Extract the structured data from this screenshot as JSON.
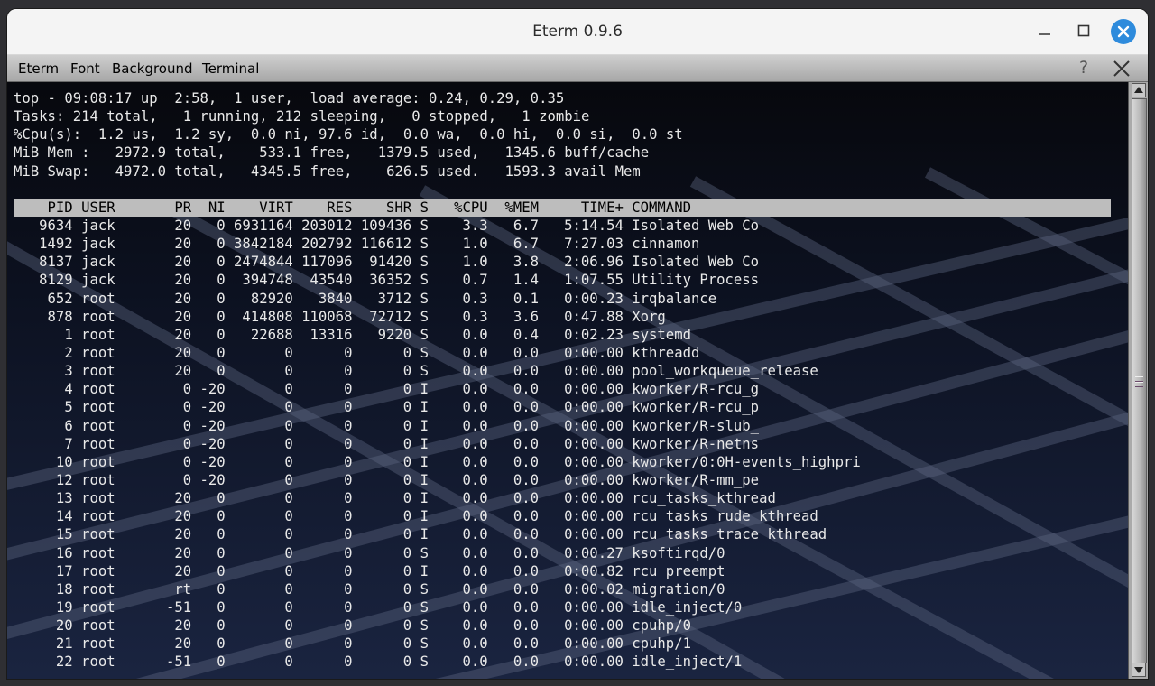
{
  "window": {
    "title": "Eterm 0.9.6"
  },
  "menubar": {
    "items": [
      "Eterm",
      "Font",
      "Background",
      "Terminal"
    ],
    "help_label": "?"
  },
  "terminal": {
    "summary": [
      "top - 09:08:17 up  2:58,  1 user,  load average: 0.24, 0.29, 0.35",
      "Tasks: 214 total,   1 running, 212 sleeping,   0 stopped,   1 zombie",
      "%Cpu(s):  1.2 us,  1.2 sy,  0.0 ni, 97.6 id,  0.0 wa,  0.0 hi,  0.0 si,  0.0 st",
      "MiB Mem :   2972.9 total,    533.1 free,   1379.5 used,   1345.6 buff/cache",
      "MiB Swap:   4972.0 total,   4345.5 free,    626.5 used.   1593.3 avail Mem",
      ""
    ],
    "columns": [
      "PID",
      "USER",
      "PR",
      "NI",
      "VIRT",
      "RES",
      "SHR",
      "S",
      "%CPU",
      "%MEM",
      "TIME+",
      "COMMAND"
    ],
    "processes": [
      {
        "pid": "9634",
        "user": "jack",
        "pr": "20",
        "ni": "0",
        "virt": "6931164",
        "res": "203012",
        "shr": "109436",
        "s": "S",
        "cpu": "3.3",
        "mem": "6.7",
        "time": "5:14.54",
        "cmd": "Isolated Web Co"
      },
      {
        "pid": "1492",
        "user": "jack",
        "pr": "20",
        "ni": "0",
        "virt": "3842184",
        "res": "202792",
        "shr": "116612",
        "s": "S",
        "cpu": "1.0",
        "mem": "6.7",
        "time": "7:27.03",
        "cmd": "cinnamon"
      },
      {
        "pid": "8137",
        "user": "jack",
        "pr": "20",
        "ni": "0",
        "virt": "2474844",
        "res": "117096",
        "shr": "91420",
        "s": "S",
        "cpu": "1.0",
        "mem": "3.8",
        "time": "2:06.96",
        "cmd": "Isolated Web Co"
      },
      {
        "pid": "8129",
        "user": "jack",
        "pr": "20",
        "ni": "0",
        "virt": "394748",
        "res": "43540",
        "shr": "36352",
        "s": "S",
        "cpu": "0.7",
        "mem": "1.4",
        "time": "1:07.55",
        "cmd": "Utility Process"
      },
      {
        "pid": "652",
        "user": "root",
        "pr": "20",
        "ni": "0",
        "virt": "82920",
        "res": "3840",
        "shr": "3712",
        "s": "S",
        "cpu": "0.3",
        "mem": "0.1",
        "time": "0:00.23",
        "cmd": "irqbalance"
      },
      {
        "pid": "878",
        "user": "root",
        "pr": "20",
        "ni": "0",
        "virt": "414808",
        "res": "110068",
        "shr": "72712",
        "s": "S",
        "cpu": "0.3",
        "mem": "3.6",
        "time": "0:47.88",
        "cmd": "Xorg"
      },
      {
        "pid": "1",
        "user": "root",
        "pr": "20",
        "ni": "0",
        "virt": "22688",
        "res": "13316",
        "shr": "9220",
        "s": "S",
        "cpu": "0.0",
        "mem": "0.4",
        "time": "0:02.23",
        "cmd": "systemd"
      },
      {
        "pid": "2",
        "user": "root",
        "pr": "20",
        "ni": "0",
        "virt": "0",
        "res": "0",
        "shr": "0",
        "s": "S",
        "cpu": "0.0",
        "mem": "0.0",
        "time": "0:00.00",
        "cmd": "kthreadd"
      },
      {
        "pid": "3",
        "user": "root",
        "pr": "20",
        "ni": "0",
        "virt": "0",
        "res": "0",
        "shr": "0",
        "s": "S",
        "cpu": "0.0",
        "mem": "0.0",
        "time": "0:00.00",
        "cmd": "pool_workqueue_release"
      },
      {
        "pid": "4",
        "user": "root",
        "pr": "0",
        "ni": "-20",
        "virt": "0",
        "res": "0",
        "shr": "0",
        "s": "I",
        "cpu": "0.0",
        "mem": "0.0",
        "time": "0:00.00",
        "cmd": "kworker/R-rcu_g"
      },
      {
        "pid": "5",
        "user": "root",
        "pr": "0",
        "ni": "-20",
        "virt": "0",
        "res": "0",
        "shr": "0",
        "s": "I",
        "cpu": "0.0",
        "mem": "0.0",
        "time": "0:00.00",
        "cmd": "kworker/R-rcu_p"
      },
      {
        "pid": "6",
        "user": "root",
        "pr": "0",
        "ni": "-20",
        "virt": "0",
        "res": "0",
        "shr": "0",
        "s": "I",
        "cpu": "0.0",
        "mem": "0.0",
        "time": "0:00.00",
        "cmd": "kworker/R-slub_"
      },
      {
        "pid": "7",
        "user": "root",
        "pr": "0",
        "ni": "-20",
        "virt": "0",
        "res": "0",
        "shr": "0",
        "s": "I",
        "cpu": "0.0",
        "mem": "0.0",
        "time": "0:00.00",
        "cmd": "kworker/R-netns"
      },
      {
        "pid": "10",
        "user": "root",
        "pr": "0",
        "ni": "-20",
        "virt": "0",
        "res": "0",
        "shr": "0",
        "s": "I",
        "cpu": "0.0",
        "mem": "0.0",
        "time": "0:00.00",
        "cmd": "kworker/0:0H-events_highpri"
      },
      {
        "pid": "12",
        "user": "root",
        "pr": "0",
        "ni": "-20",
        "virt": "0",
        "res": "0",
        "shr": "0",
        "s": "I",
        "cpu": "0.0",
        "mem": "0.0",
        "time": "0:00.00",
        "cmd": "kworker/R-mm_pe"
      },
      {
        "pid": "13",
        "user": "root",
        "pr": "20",
        "ni": "0",
        "virt": "0",
        "res": "0",
        "shr": "0",
        "s": "I",
        "cpu": "0.0",
        "mem": "0.0",
        "time": "0:00.00",
        "cmd": "rcu_tasks_kthread"
      },
      {
        "pid": "14",
        "user": "root",
        "pr": "20",
        "ni": "0",
        "virt": "0",
        "res": "0",
        "shr": "0",
        "s": "I",
        "cpu": "0.0",
        "mem": "0.0",
        "time": "0:00.00",
        "cmd": "rcu_tasks_rude_kthread"
      },
      {
        "pid": "15",
        "user": "root",
        "pr": "20",
        "ni": "0",
        "virt": "0",
        "res": "0",
        "shr": "0",
        "s": "I",
        "cpu": "0.0",
        "mem": "0.0",
        "time": "0:00.00",
        "cmd": "rcu_tasks_trace_kthread"
      },
      {
        "pid": "16",
        "user": "root",
        "pr": "20",
        "ni": "0",
        "virt": "0",
        "res": "0",
        "shr": "0",
        "s": "S",
        "cpu": "0.0",
        "mem": "0.0",
        "time": "0:00.27",
        "cmd": "ksoftirqd/0"
      },
      {
        "pid": "17",
        "user": "root",
        "pr": "20",
        "ni": "0",
        "virt": "0",
        "res": "0",
        "shr": "0",
        "s": "I",
        "cpu": "0.0",
        "mem": "0.0",
        "time": "0:00.82",
        "cmd": "rcu_preempt"
      },
      {
        "pid": "18",
        "user": "root",
        "pr": "rt",
        "ni": "0",
        "virt": "0",
        "res": "0",
        "shr": "0",
        "s": "S",
        "cpu": "0.0",
        "mem": "0.0",
        "time": "0:00.02",
        "cmd": "migration/0"
      },
      {
        "pid": "19",
        "user": "root",
        "pr": "-51",
        "ni": "0",
        "virt": "0",
        "res": "0",
        "shr": "0",
        "s": "S",
        "cpu": "0.0",
        "mem": "0.0",
        "time": "0:00.00",
        "cmd": "idle_inject/0"
      },
      {
        "pid": "20",
        "user": "root",
        "pr": "20",
        "ni": "0",
        "virt": "0",
        "res": "0",
        "shr": "0",
        "s": "S",
        "cpu": "0.0",
        "mem": "0.0",
        "time": "0:00.00",
        "cmd": "cpuhp/0"
      },
      {
        "pid": "21",
        "user": "root",
        "pr": "20",
        "ni": "0",
        "virt": "0",
        "res": "0",
        "shr": "0",
        "s": "S",
        "cpu": "0.0",
        "mem": "0.0",
        "time": "0:00.00",
        "cmd": "cpuhp/1"
      },
      {
        "pid": "22",
        "user": "root",
        "pr": "-51",
        "ni": "0",
        "virt": "0",
        "res": "0",
        "shr": "0",
        "s": "S",
        "cpu": "0.0",
        "mem": "0.0",
        "time": "0:00.00",
        "cmd": "idle_inject/1"
      }
    ]
  },
  "icons": {
    "minimize": "minimize-icon",
    "maximize": "maximize-icon",
    "close": "close-icon",
    "menu_close": "close-icon",
    "scroll_up": "arrow-up-icon",
    "scroll_down": "arrow-down-icon"
  },
  "colors": {
    "terminal_text": "#e9e9e9",
    "header_bar": "#bdbdbd",
    "close_button": "#2e8bdc",
    "terminal_bg": "#0a0c14"
  }
}
